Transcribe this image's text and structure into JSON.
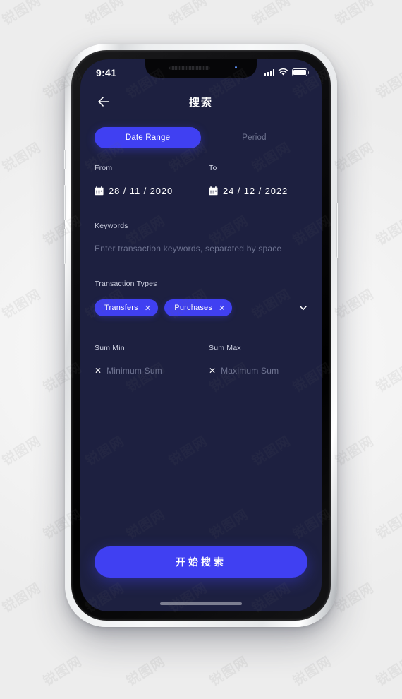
{
  "status_bar": {
    "time": "9:41",
    "icons": [
      "cellular-signal-icon",
      "wifi-icon",
      "battery-icon"
    ]
  },
  "app_bar": {
    "back_icon": "arrow-left-icon",
    "title": "搜索"
  },
  "segmented_control": {
    "tabs": [
      {
        "label": "Date Range",
        "active": true
      },
      {
        "label": "Period",
        "active": false
      }
    ]
  },
  "date_range": {
    "from": {
      "label": "From",
      "value": "28 / 11 / 2020",
      "icon": "calendar-icon"
    },
    "to": {
      "label": "To",
      "value": "24 / 12 / 2022",
      "icon": "calendar-icon"
    }
  },
  "keywords": {
    "label": "Keywords",
    "value": "",
    "placeholder": "Enter transaction keywords, separated by space"
  },
  "transaction_types": {
    "label": "Transaction Types",
    "chips": [
      {
        "label": "Transfers",
        "remove_icon": "close-icon"
      },
      {
        "label": "Purchases",
        "remove_icon": "close-icon"
      }
    ],
    "expand_icon": "chevron-down-icon"
  },
  "sum": {
    "min": {
      "label": "Sum Min",
      "value": "",
      "placeholder": "Minimum Sum",
      "icon": "currency-x-icon"
    },
    "max": {
      "label": "Sum Max",
      "value": "",
      "placeholder": "Maximum Sum",
      "icon": "currency-x-icon"
    }
  },
  "cta": {
    "label": "开始搜索"
  },
  "colors": {
    "accent": "#4040f2",
    "screen_background": "#1d2040",
    "divider": "#3a3f66",
    "muted_text": "#6e7391",
    "label_text": "#cfd2e2"
  },
  "watermark": {
    "text": "锐图网"
  }
}
